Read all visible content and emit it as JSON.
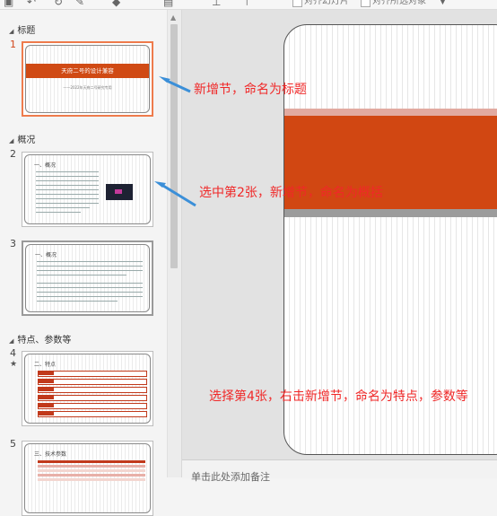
{
  "toolbar": {
    "checkbox1_label": "对齐幻灯片",
    "checkbox2_label": "对齐所选对象"
  },
  "sections": [
    {
      "label": "标题"
    },
    {
      "label": "概况"
    },
    {
      "label": "特点、参数等"
    }
  ],
  "slides": [
    {
      "number": "1",
      "title": "天府二号的设计兼容",
      "subtitle": "——2022年天府二号研究专用"
    },
    {
      "number": "2",
      "title": "一、概况"
    },
    {
      "number": "3",
      "title": "一、概况"
    },
    {
      "number": "4",
      "title": "二、特点",
      "mark": "★"
    },
    {
      "number": "5",
      "title": "三、技术参数"
    }
  ],
  "notes_placeholder": "单击此处添加备注",
  "annotations": {
    "a1": "新增节，命名为标题",
    "a2": "选中第2张，新增节，命名为概括",
    "a3": "选择第4张，右击新增节，命名为特点，参数等"
  },
  "colors": {
    "accent": "#d14712",
    "annotation": "#f02828",
    "selection": "#ee7b4c"
  }
}
